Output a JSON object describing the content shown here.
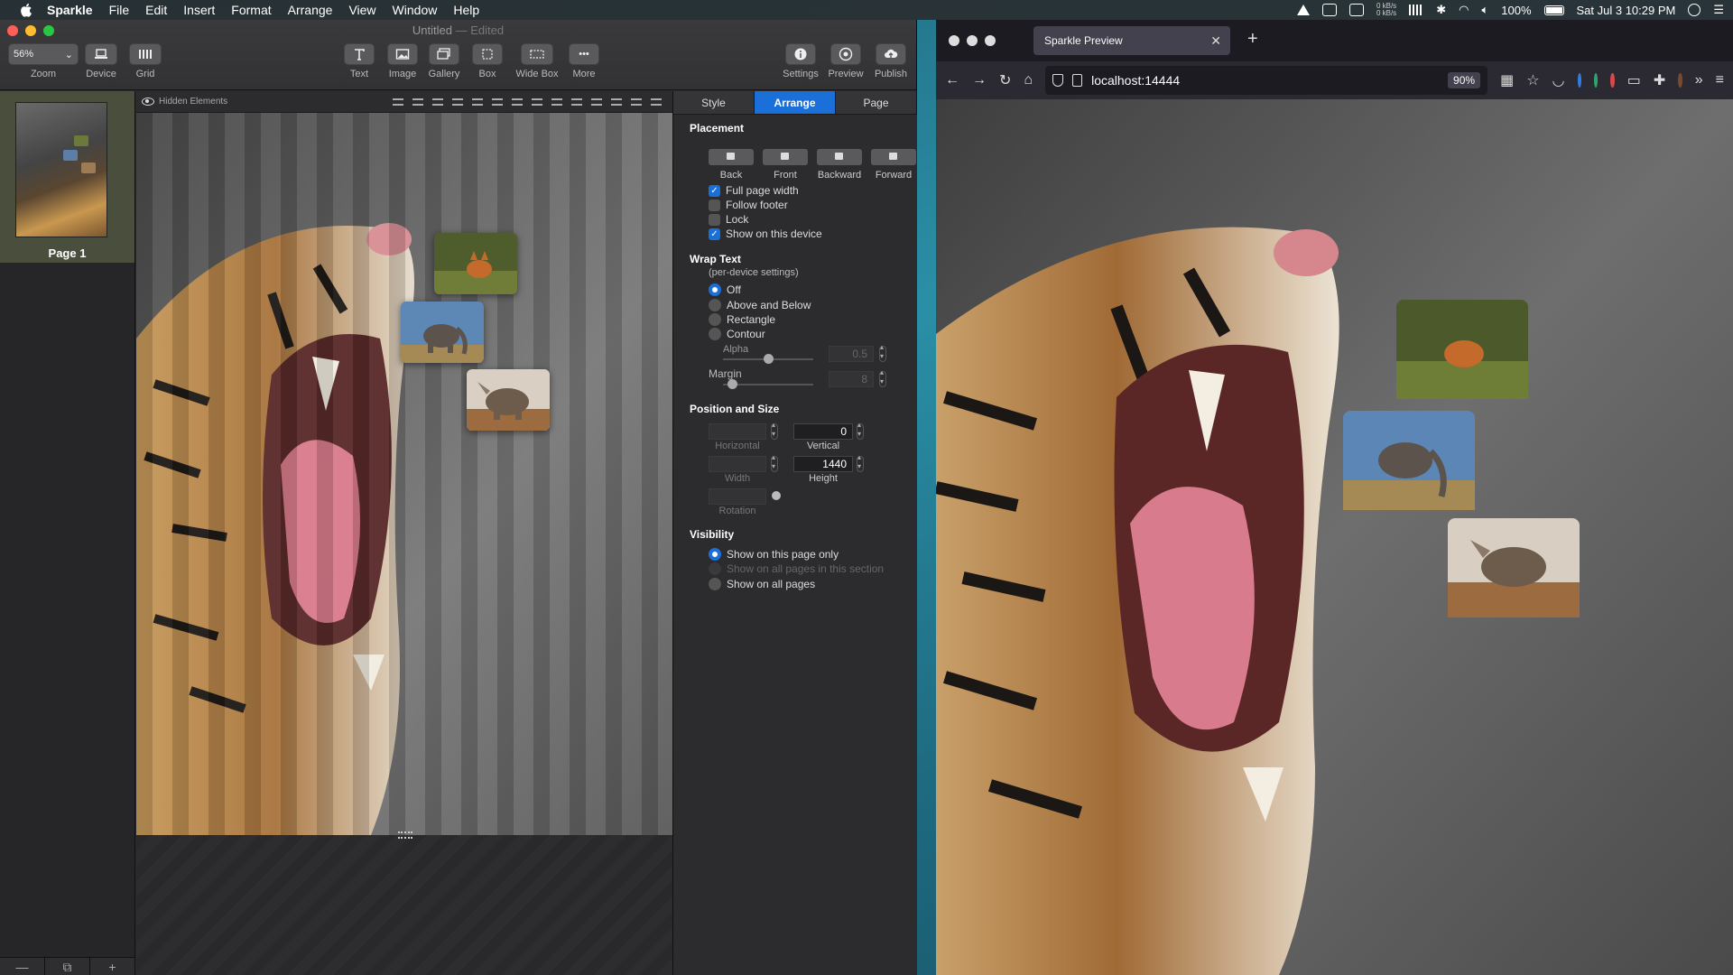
{
  "menubar": {
    "app_name": "Sparkle",
    "items": [
      "File",
      "Edit",
      "Insert",
      "Format",
      "Arrange",
      "View",
      "Window",
      "Help"
    ],
    "net_up": "0 kB/s",
    "net_down": "0 kB/s",
    "battery": "100%",
    "clock": "Sat Jul 3  10:29 PM"
  },
  "sparkle": {
    "title": "Untitled",
    "title_status": "— Edited",
    "toolbar": {
      "zoom_value": "56%",
      "zoom_label": "Zoom",
      "device_label": "Device",
      "grid_label": "Grid",
      "text_label": "Text",
      "image_label": "Image",
      "gallery_label": "Gallery",
      "box_label": "Box",
      "widebox_label": "Wide Box",
      "more_label": "More",
      "settings_label": "Settings",
      "preview_label": "Preview",
      "publish_label": "Publish"
    },
    "sidebar": {
      "page_label": "Page 1",
      "bottom_buttons": [
        "—",
        "⧉",
        "+"
      ]
    },
    "canvas": {
      "hidden_elements_label": "Hidden Elements"
    },
    "inspector": {
      "tabs": [
        {
          "label": "Style",
          "active": false
        },
        {
          "label": "Arrange",
          "active": true
        },
        {
          "label": "Page",
          "active": false
        }
      ],
      "placement": {
        "title": "Placement",
        "buttons": [
          "Back",
          "Front",
          "Backward",
          "Forward"
        ],
        "options": [
          {
            "label": "Full page width",
            "checked": true
          },
          {
            "label": "Follow footer",
            "checked": false
          },
          {
            "label": "Lock",
            "checked": false
          },
          {
            "label": "Show on this device",
            "checked": true
          }
        ]
      },
      "wrap_text": {
        "title": "Wrap Text",
        "subtitle": "(per-device settings)",
        "options": [
          {
            "label": "Off",
            "selected": true
          },
          {
            "label": "Above and Below",
            "selected": false
          },
          {
            "label": "Rectangle",
            "selected": false
          },
          {
            "label": "Contour",
            "selected": false
          }
        ],
        "alpha_label": "Alpha",
        "alpha_value": "0.5",
        "alpha_level": 0.5,
        "margin_label": "Margin",
        "margin_value": "8",
        "margin_level": 0.1
      },
      "position_size": {
        "title": "Position and Size",
        "horizontal_label": "Horizontal",
        "horizontal_value": "",
        "vertical_label": "Vertical",
        "vertical_value": "0",
        "width_label": "Width",
        "width_value": "",
        "height_label": "Height",
        "height_value": "1440",
        "rotation_label": "Rotation"
      },
      "visibility": {
        "title": "Visibility",
        "options": [
          {
            "label": "Show on this page only",
            "selected": true,
            "enabled": true
          },
          {
            "label": "Show on all pages in this section",
            "selected": false,
            "enabled": false
          },
          {
            "label": "Show on all pages",
            "selected": false,
            "enabled": true
          }
        ]
      }
    }
  },
  "browser": {
    "tab_title": "Sparkle Preview",
    "url": "localhost:14444",
    "zoom": "90%"
  },
  "colors": {
    "accent": "#1a6fd9",
    "panel": "#2c2c2e",
    "browser_chrome": "#2b2a33"
  }
}
